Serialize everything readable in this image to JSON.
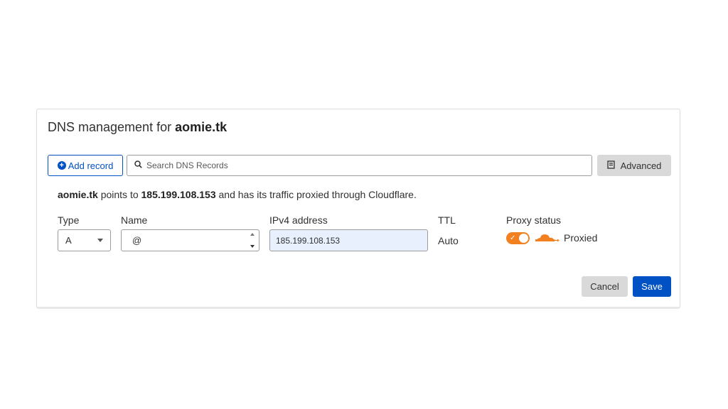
{
  "header": {
    "title_prefix": "DNS management for ",
    "domain": "aomie.tk"
  },
  "toolbar": {
    "add_record_label": "Add record",
    "add_icon": "plus-circle-icon",
    "search_placeholder": "Search DNS Records",
    "search_icon": "search-icon",
    "advanced_label": "Advanced",
    "advanced_icon": "book-icon"
  },
  "info": {
    "domain": "aomie.tk",
    "text_1": " points to ",
    "ip": "185.199.108.153",
    "text_2": " and has its traffic proxied through Cloudflare."
  },
  "record_form": {
    "type_label": "Type",
    "type_value": "A",
    "name_label": "Name",
    "name_value": "@",
    "ipv4_label": "IPv4 address",
    "ipv4_value": "185.199.108.153",
    "ttl_label": "TTL",
    "ttl_value": "Auto",
    "proxy_label": "Proxy status",
    "proxy_value": "Proxied",
    "proxy_enabled": true,
    "proxy_icon": "cloud-icon"
  },
  "actions": {
    "cancel_label": "Cancel",
    "save_label": "Save"
  },
  "colors": {
    "primary": "#0051c3",
    "proxy_orange": "#f38020",
    "input_autofill": "#e8f0fe",
    "secondary_button": "#d9d9d9"
  }
}
